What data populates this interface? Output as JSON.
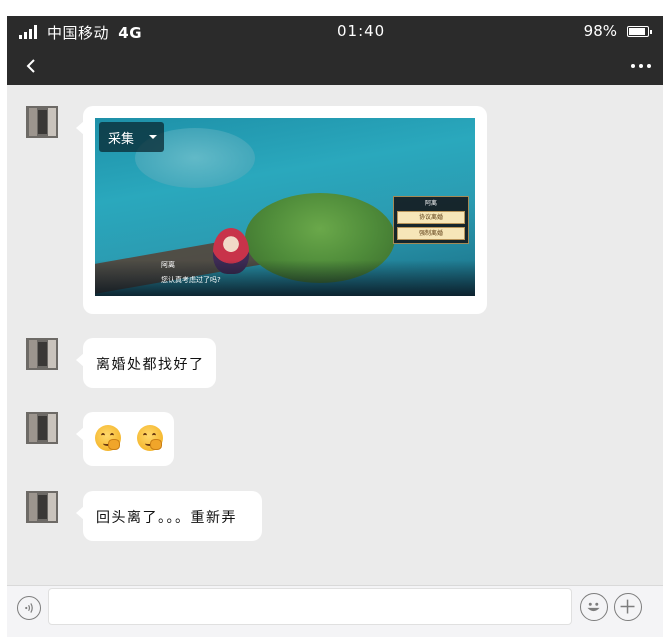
{
  "status_bar": {
    "carrier": "中国移动",
    "network": "4G",
    "time": "01:40",
    "battery": "98%"
  },
  "nav": {
    "back_icon": "chevron-left-icon",
    "more_icon": "more-dots-icon"
  },
  "game_screenshot": {
    "collect_label": "采集",
    "npc_name": "阿离",
    "npc_line": "您认真考虑过了吗?",
    "dialog_title": "阿离",
    "options": [
      "协议离婚",
      "强制离婚"
    ]
  },
  "messages": [
    {
      "type": "image"
    },
    {
      "type": "text",
      "text": "离婚处都找好了"
    },
    {
      "type": "emoji",
      "emoji": [
        "thinking-face-icon",
        "thinking-face-icon"
      ]
    },
    {
      "type": "text",
      "text": "回头离了。。。重新弄"
    }
  ],
  "input_bar": {
    "voice_icon": "voice-icon",
    "emoji_icon": "emoji-icon",
    "plus_icon": "plus-icon",
    "input_value": ""
  }
}
